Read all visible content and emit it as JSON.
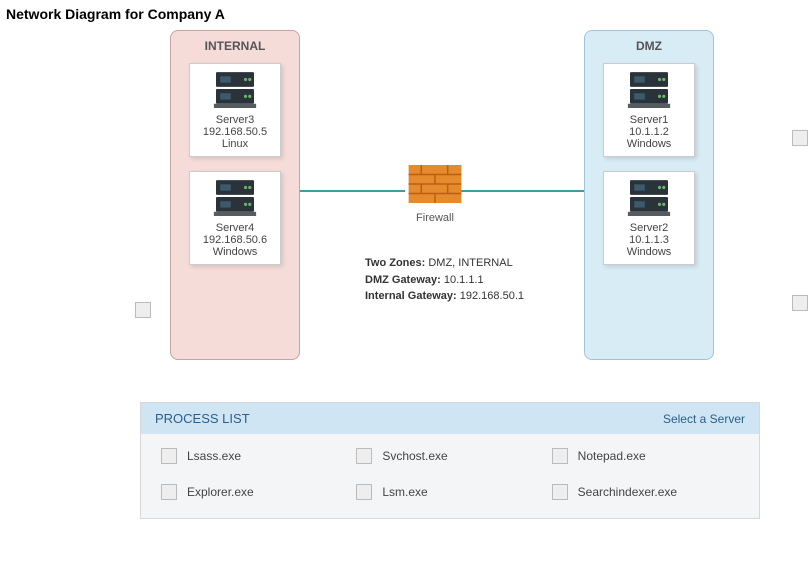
{
  "title": "Network Diagram for Company A",
  "zones": {
    "internal": {
      "label": "INTERNAL"
    },
    "dmz": {
      "label": "DMZ"
    }
  },
  "servers": {
    "s3": {
      "name": "Server3",
      "ip": "192.168.50.5",
      "os": "Linux"
    },
    "s4": {
      "name": "Server4",
      "ip": "192.168.50.6",
      "os": "Windows"
    },
    "s1": {
      "name": "Server1",
      "ip": "10.1.1.2",
      "os": "Windows"
    },
    "s2": {
      "name": "Server2",
      "ip": "10.1.1.3",
      "os": "Windows"
    }
  },
  "firewall": {
    "label": "Firewall"
  },
  "zoneInfo": {
    "zonesLabel": "Two Zones:",
    "zonesValue": " DMZ, INTERNAL",
    "dmzGwLabel": "DMZ Gateway:",
    "dmzGwValue": " 10.1.1.1",
    "intGwLabel": "Internal Gateway:",
    "intGwValue": " 192.168.50.1"
  },
  "processList": {
    "header": "PROCESS LIST",
    "select": "Select a Server",
    "items": [
      "Lsass.exe",
      "Svchost.exe",
      "Notepad.exe",
      "Explorer.exe",
      "Lsm.exe",
      "Searchindexer.exe"
    ]
  }
}
